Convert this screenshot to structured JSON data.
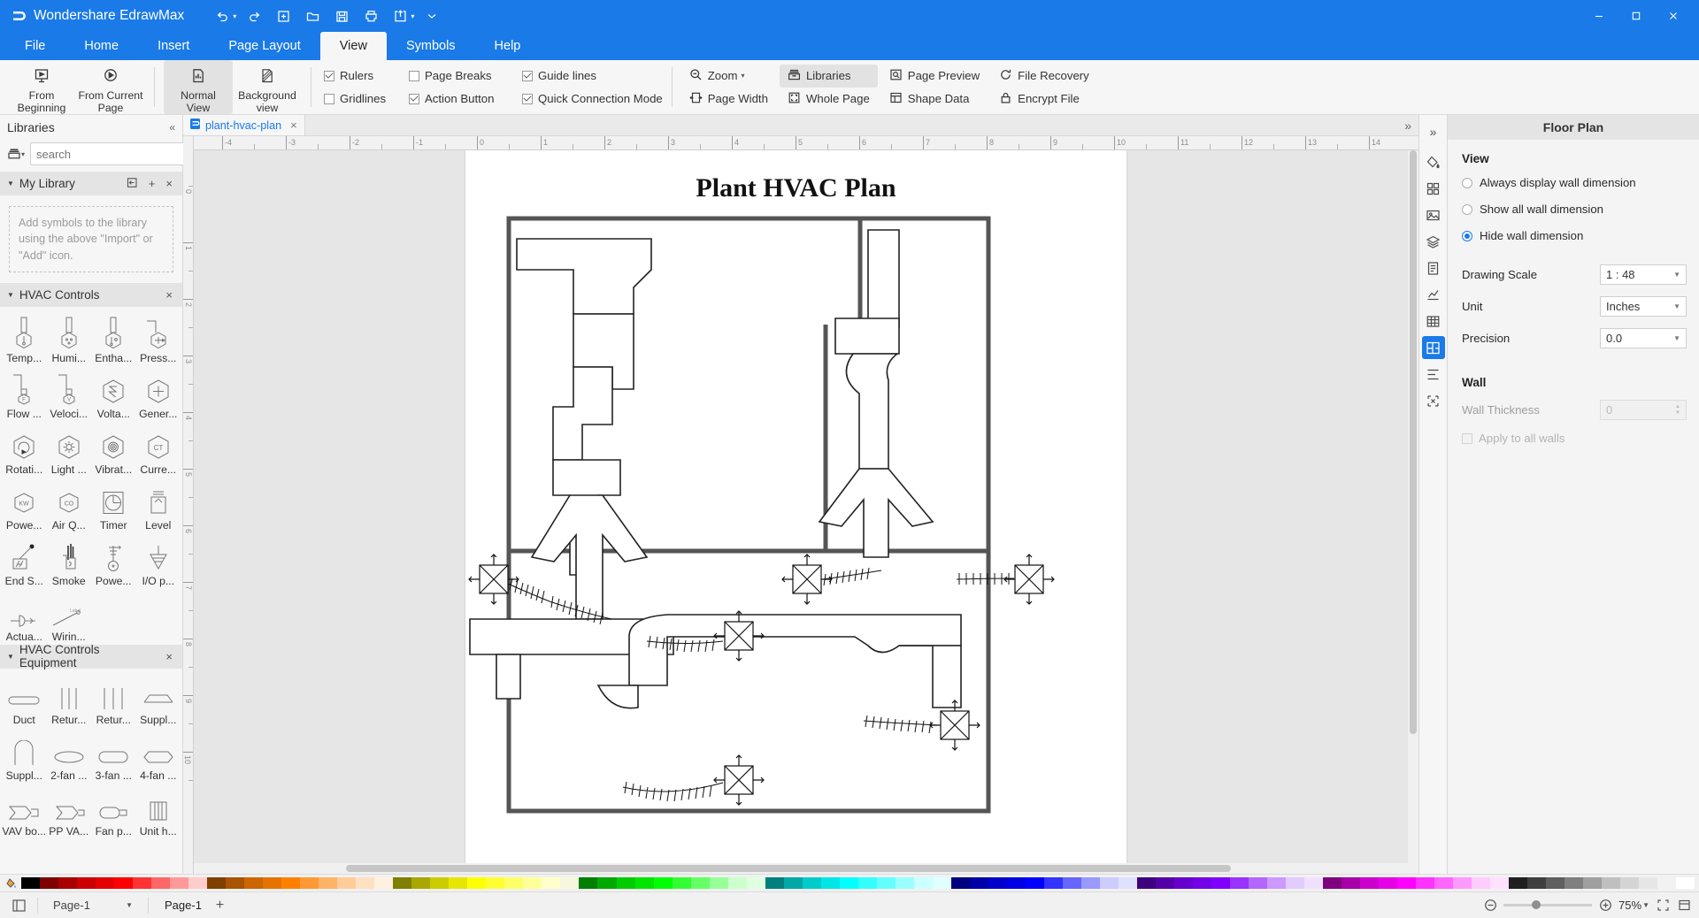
{
  "window": {
    "app_title": "Wondershare EdrawMax",
    "logo_icon": "edraw-logo-icon",
    "quick_access": [
      {
        "name": "undo",
        "icon": "undo-icon",
        "has_caret": true
      },
      {
        "name": "redo",
        "icon": "redo-icon",
        "has_caret": false
      },
      {
        "name": "new",
        "icon": "new-file-icon",
        "has_caret": false
      },
      {
        "name": "open",
        "icon": "folder-open-icon",
        "has_caret": false
      },
      {
        "name": "save",
        "icon": "save-icon",
        "has_caret": false
      },
      {
        "name": "print",
        "icon": "printer-icon",
        "has_caret": false
      },
      {
        "name": "share",
        "icon": "share-export-icon",
        "has_caret": true
      },
      {
        "name": "customize",
        "icon": "chevron-down-icon",
        "has_caret": false
      }
    ],
    "controls": [
      {
        "name": "minimize",
        "icon": "minimize-icon"
      },
      {
        "name": "maximize",
        "icon": "maximize-icon"
      },
      {
        "name": "close",
        "icon": "close-icon"
      }
    ]
  },
  "menu": {
    "tabs": [
      {
        "label": "File",
        "active": false
      },
      {
        "label": "Home",
        "active": false
      },
      {
        "label": "Insert",
        "active": false
      },
      {
        "label": "Page Layout",
        "active": false
      },
      {
        "label": "View",
        "active": true
      },
      {
        "label": "Symbols",
        "active": false
      },
      {
        "label": "Help",
        "active": false
      }
    ]
  },
  "ribbon": {
    "buttons": [
      {
        "label": "From\nBeginning",
        "icon": "present-from-beginning-icon",
        "active": false
      },
      {
        "label": "From Current\nPage",
        "icon": "present-from-current-icon",
        "active": false
      },
      {
        "label": "Normal\nView",
        "icon": "normal-view-icon",
        "active": true
      },
      {
        "label": "Background\nview",
        "icon": "background-view-icon",
        "active": false
      }
    ],
    "checkboxes": [
      {
        "label": "Rulers",
        "checked": true
      },
      {
        "label": "Page Breaks",
        "checked": false
      },
      {
        "label": "Guide lines",
        "checked": true
      },
      {
        "label": "Gridlines",
        "checked": false
      },
      {
        "label": "Action Button",
        "checked": true
      },
      {
        "label": "Quick Connection Mode",
        "checked": true
      }
    ],
    "tools": [
      {
        "label": "Zoom",
        "icon": "zoom-out-icon",
        "caret": true,
        "active": false
      },
      {
        "label": "Libraries",
        "icon": "libraries-icon",
        "caret": false,
        "active": true
      },
      {
        "label": "Page Preview",
        "icon": "page-preview-icon",
        "caret": false,
        "active": false
      },
      {
        "label": "File Recovery",
        "icon": "file-recovery-icon",
        "caret": false,
        "active": false
      },
      {
        "label": "Page Width",
        "icon": "page-width-icon",
        "caret": false,
        "active": false
      },
      {
        "label": "Whole Page",
        "icon": "whole-page-icon",
        "caret": false,
        "active": false
      },
      {
        "label": "Shape Data",
        "icon": "shape-data-icon",
        "caret": false,
        "active": false
      },
      {
        "label": "Encrypt File",
        "icon": "encrypt-file-icon",
        "caret": false,
        "active": false
      }
    ]
  },
  "libraries": {
    "title": "Libraries",
    "search_placeholder": "search",
    "search_value": "",
    "my_library": {
      "title": "My Library",
      "empty_text": "Add symbols to the library using the above \"Import\" or \"Add\" icon.",
      "actions": [
        "import-icon",
        "add-icon",
        "close-icon"
      ]
    },
    "sections": [
      {
        "title": "HVAC Controls",
        "symbols": [
          {
            "label": "Temp...",
            "icon": "temperature-sensor-icon"
          },
          {
            "label": "Humi...",
            "icon": "humidity-sensor-icon"
          },
          {
            "label": "Entha...",
            "icon": "enthalpy-sensor-icon"
          },
          {
            "label": "Press...",
            "icon": "pressure-sensor-icon"
          },
          {
            "label": "Flow ...",
            "icon": "flow-sensor-icon"
          },
          {
            "label": "Veloci...",
            "icon": "velocity-sensor-icon"
          },
          {
            "label": "Volta...",
            "icon": "voltage-sensor-icon"
          },
          {
            "label": "Gener...",
            "icon": "generic-sensor-icon"
          },
          {
            "label": "Rotati...",
            "icon": "rotation-sensor-icon"
          },
          {
            "label": "Light ...",
            "icon": "light-sensor-icon"
          },
          {
            "label": "Vibrat...",
            "icon": "vibration-sensor-icon"
          },
          {
            "label": "Curre...",
            "icon": "current-sensor-icon"
          },
          {
            "label": "Powe...",
            "icon": "power-kw-icon"
          },
          {
            "label": "Air Q...",
            "icon": "air-quality-co-icon"
          },
          {
            "label": "Timer",
            "icon": "timer-icon"
          },
          {
            "label": "Level",
            "icon": "level-sensor-icon"
          },
          {
            "label": "End S...",
            "icon": "end-switch-icon"
          },
          {
            "label": "Smoke",
            "icon": "smoke-detector-icon"
          },
          {
            "label": "Powe...",
            "icon": "power-supply-icon"
          },
          {
            "label": "I/O p...",
            "icon": "io-point-icon"
          },
          {
            "label": "Actua...",
            "icon": "actuator-icon"
          },
          {
            "label": "Wirin...",
            "icon": "wiring-label-icon"
          }
        ]
      },
      {
        "title": "HVAC Controls Equipment",
        "symbols": [
          {
            "label": "Duct",
            "icon": "duct-icon"
          },
          {
            "label": "Retur...",
            "icon": "return-duct-icon"
          },
          {
            "label": "Retur...",
            "icon": "return-air-icon"
          },
          {
            "label": "Suppl...",
            "icon": "supply-duct-icon"
          },
          {
            "label": "Suppl...",
            "icon": "supply-diffuser-icon"
          },
          {
            "label": "2-fan ...",
            "icon": "two-fan-unit-icon"
          },
          {
            "label": "3-fan ...",
            "icon": "three-fan-unit-icon"
          },
          {
            "label": "4-fan ...",
            "icon": "four-fan-unit-icon"
          },
          {
            "label": "VAV bo...",
            "icon": "vav-box-icon"
          },
          {
            "label": "PP VA...",
            "icon": "pp-vav-icon"
          },
          {
            "label": "Fan p...",
            "icon": "fan-powered-icon"
          },
          {
            "label": "Unit h...",
            "icon": "unit-heater-icon"
          }
        ]
      }
    ]
  },
  "document": {
    "tab_label": "plant-hvac-plan",
    "tab_icon": "document-icon",
    "drawing_title": "Plant HVAC Plan",
    "h_ruler_labels": [
      "-4",
      "-3",
      "-2",
      "-1",
      "0",
      "1",
      "2",
      "3",
      "4",
      "5",
      "6",
      "7",
      "8",
      "9",
      "10",
      "11",
      "12",
      "13",
      "14"
    ],
    "v_ruler_labels": [
      "0",
      "1",
      "2",
      "3",
      "4",
      "5",
      "6",
      "7",
      "8",
      "9",
      "10"
    ]
  },
  "rail": {
    "buttons": [
      {
        "name": "expand-panel",
        "icon": "chevron-double-right-icon",
        "active": false
      },
      {
        "name": "fill-style",
        "icon": "paint-bucket-icon",
        "active": false
      },
      {
        "name": "theme",
        "icon": "grid-theme-icon",
        "active": false
      },
      {
        "name": "picture",
        "icon": "picture-icon",
        "active": false
      },
      {
        "name": "layers",
        "icon": "layers-icon",
        "active": false
      },
      {
        "name": "page-setup",
        "icon": "page-setup-icon",
        "active": false
      },
      {
        "name": "chart",
        "icon": "chart-icon",
        "active": false
      },
      {
        "name": "table",
        "icon": "table-icon",
        "active": false
      },
      {
        "name": "floor-plan",
        "icon": "floor-plan-icon",
        "active": true
      },
      {
        "name": "align",
        "icon": "align-icon",
        "active": false
      },
      {
        "name": "arrange",
        "icon": "arrange-icon",
        "active": false
      }
    ]
  },
  "properties": {
    "title": "Floor Plan",
    "view_section": "View",
    "radios": [
      {
        "label": "Always display wall dimension",
        "selected": false
      },
      {
        "label": "Show all wall dimension",
        "selected": false
      },
      {
        "label": "Hide wall dimension",
        "selected": true
      }
    ],
    "fields": [
      {
        "label": "Drawing Scale",
        "value": "1 : 48",
        "disabled": false
      },
      {
        "label": "Unit",
        "value": "Inches",
        "disabled": false
      },
      {
        "label": "Precision",
        "value": "0.0",
        "disabled": false
      }
    ],
    "wall_section": "Wall",
    "wall_thickness": {
      "label": "Wall Thickness",
      "value": "0",
      "disabled": true
    },
    "apply_all": {
      "label": "Apply to all walls",
      "checked": false,
      "disabled": true
    }
  },
  "colorbar": {
    "picker_icon": "color-picker-icon",
    "swatches": [
      "#000000",
      "#7f0000",
      "#a80000",
      "#cc0000",
      "#e60000",
      "#ff0000",
      "#ff3333",
      "#ff6666",
      "#ff9999",
      "#ffcccc",
      "#7f3f00",
      "#a85400",
      "#cc6600",
      "#e67300",
      "#ff8000",
      "#ff9933",
      "#ffb366",
      "#ffcc99",
      "#ffe0c2",
      "#fff0e0",
      "#7f7f00",
      "#a8a800",
      "#cccc00",
      "#e6e600",
      "#ffff00",
      "#ffff33",
      "#ffff66",
      "#ffff99",
      "#ffffcc",
      "#f7f7e0",
      "#007f00",
      "#00a800",
      "#00cc00",
      "#00e600",
      "#00ff00",
      "#33ff33",
      "#66ff66",
      "#99ff99",
      "#ccffcc",
      "#e0ffe0",
      "#007f7f",
      "#00a8a8",
      "#00cccc",
      "#00e6e6",
      "#00ffff",
      "#33ffff",
      "#66ffff",
      "#99ffff",
      "#ccffff",
      "#e0ffff",
      "#00007f",
      "#0000a8",
      "#0000cc",
      "#0000e6",
      "#0000ff",
      "#3333ff",
      "#6666ff",
      "#9999ff",
      "#ccccff",
      "#e0e0ff",
      "#3f007f",
      "#5400a8",
      "#6600cc",
      "#7300e6",
      "#8000ff",
      "#9933ff",
      "#b366ff",
      "#cc99ff",
      "#e0ccff",
      "#f0e0ff",
      "#7f007f",
      "#a800a8",
      "#cc00cc",
      "#e600e6",
      "#ff00ff",
      "#ff33ff",
      "#ff66ff",
      "#ff99ff",
      "#ffccff",
      "#ffe0ff",
      "#1f1f1f",
      "#3f3f3f",
      "#5f5f5f",
      "#7f7f7f",
      "#9f9f9f",
      "#bfbfbf",
      "#d4d4d4",
      "#e6e6e6",
      "#f2f2f2",
      "#ffffff"
    ]
  },
  "statusbar": {
    "view_icon": "page-view-icon",
    "page_selector": "Page-1",
    "page_tab": "Page-1",
    "add_page_label": "+",
    "zoom_out_icon": "zoom-minus-icon",
    "zoom_in_icon": "zoom-plus-icon",
    "zoom_value": "75%",
    "fit_icon": "fit-page-icon",
    "fullscreen_icon": "fullscreen-icon"
  }
}
